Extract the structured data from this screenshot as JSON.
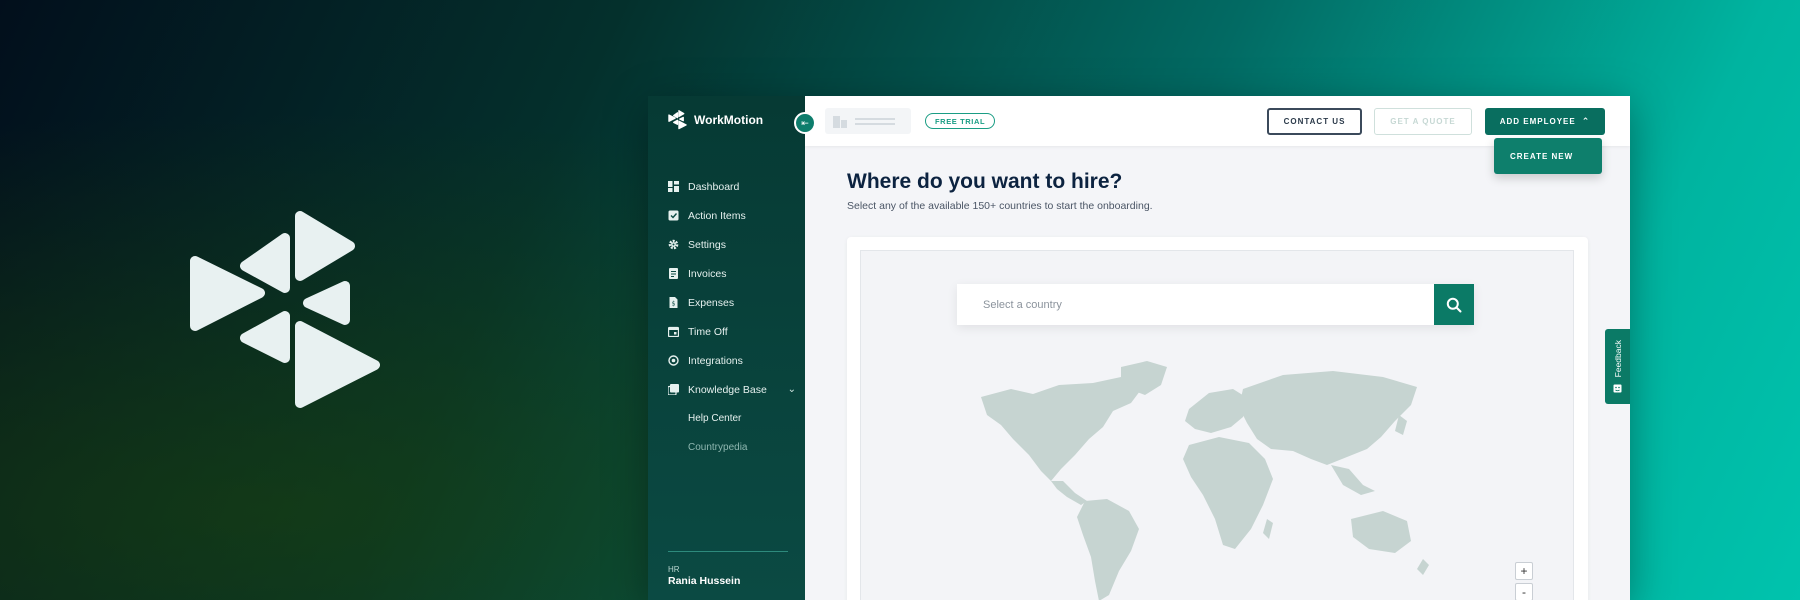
{
  "brand": {
    "name": "WorkMotion"
  },
  "sidebar": {
    "collapse_icon": "collapse-arrow-icon",
    "items": [
      {
        "label": "Dashboard",
        "icon": "grid-icon"
      },
      {
        "label": "Action Items",
        "icon": "checklist-icon"
      },
      {
        "label": "Settings",
        "icon": "gear-icon"
      },
      {
        "label": "Invoices",
        "icon": "invoice-icon"
      },
      {
        "label": "Expenses",
        "icon": "receipt-icon"
      },
      {
        "label": "Time Off",
        "icon": "calendar-icon"
      },
      {
        "label": "Integrations",
        "icon": "puzzle-icon"
      },
      {
        "label": "Knowledge Base",
        "icon": "book-icon"
      }
    ],
    "sub_items": [
      {
        "label": "Help Center"
      },
      {
        "label": "Countrypedia"
      }
    ]
  },
  "user": {
    "role": "HR",
    "name": "Rania Hussein"
  },
  "topbar": {
    "badge": "FREE TRIAL",
    "contact_label": "CONTACT US",
    "quote_label": "GET A QUOTE",
    "add_employee_label": "ADD EMPLOYEE",
    "create_new_label": "CREATE NEW"
  },
  "main": {
    "heading": "Where do you want to hire?",
    "subheading": "Select any of the available 150+ countries to start the onboarding.",
    "search": {
      "placeholder": "Select a country",
      "value": ""
    },
    "zoom_in": "+",
    "zoom_out": "-"
  },
  "feedback": {
    "label": "Feedback"
  },
  "colors": {
    "sidebar": "#063a34",
    "accent": "#0b7a66",
    "heading": "#0c2340",
    "map_land": "#c6d4d1"
  }
}
